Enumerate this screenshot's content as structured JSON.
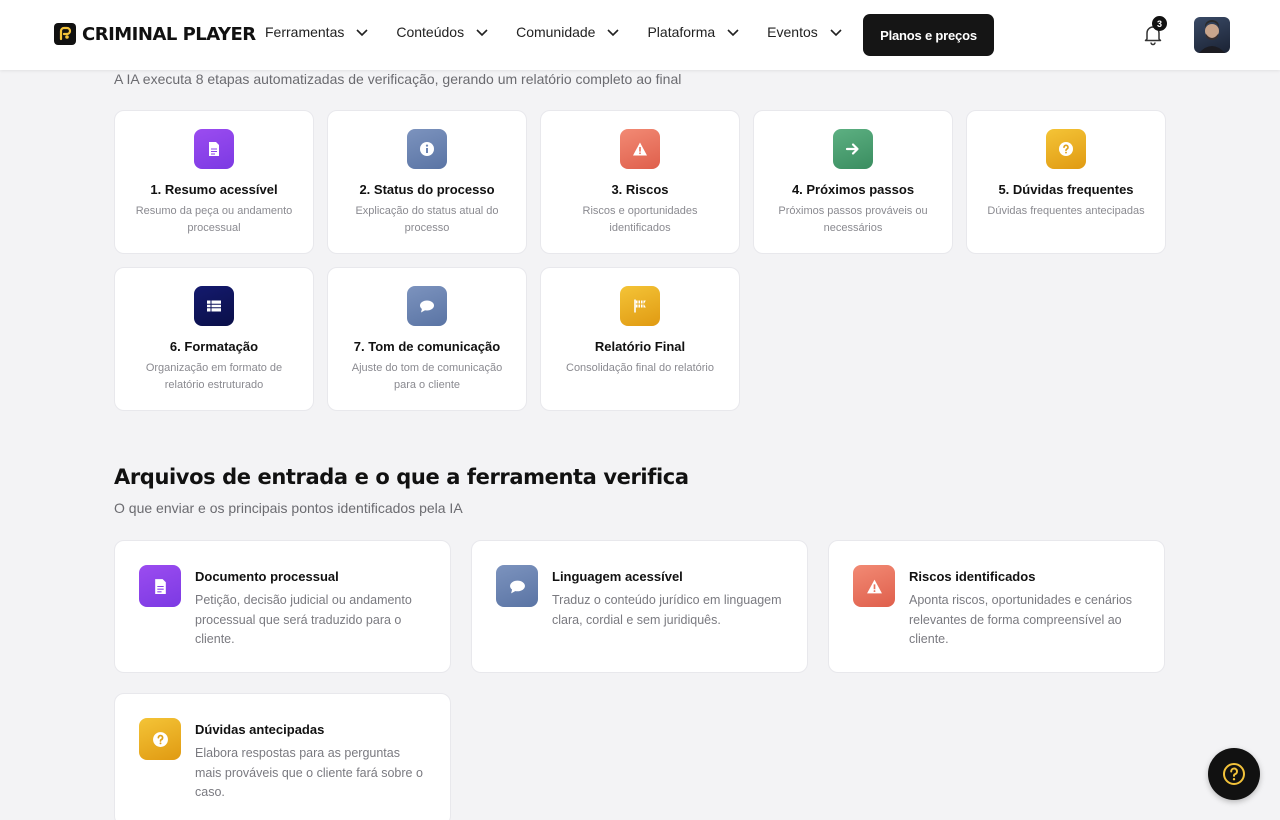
{
  "header": {
    "logo_text": "CRIMINAL PLAYER",
    "nav": [
      {
        "label": "Ferramentas"
      },
      {
        "label": "Conteúdos"
      },
      {
        "label": "Comunidade"
      },
      {
        "label": "Plataforma"
      },
      {
        "label": "Eventos"
      }
    ],
    "cta_label": "Planos e preços",
    "notification_count": "3"
  },
  "steps_section": {
    "subtitle": "A IA executa 8 etapas automatizadas de verificação, gerando um relatório completo ao final",
    "steps": [
      {
        "title": "1. Resumo acessível",
        "desc": "Resumo da peça ou andamento processual",
        "icon": "document-icon",
        "color": "#8b44ea"
      },
      {
        "title": "2. Status do processo",
        "desc": "Explicação do status atual do processo",
        "icon": "info-icon",
        "color": "#6c84b3"
      },
      {
        "title": "3. Riscos",
        "desc": "Riscos e oportunidades identificados",
        "icon": "warning-icon",
        "color": "#e8725e"
      },
      {
        "title": "4. Próximos passos",
        "desc": "Próximos passos prováveis ou necessários",
        "icon": "arrow-right-icon",
        "color": "#4b9f72"
      },
      {
        "title": "5. Dúvidas frequentes",
        "desc": "Dúvidas frequentes antecipadas",
        "icon": "question-icon",
        "color": "#eaaf25"
      },
      {
        "title": "6. Formatação",
        "desc": "Organização em formato de relatório estruturado",
        "icon": "table-icon",
        "color": "#0f145c"
      },
      {
        "title": "7. Tom de comunicação",
        "desc": "Ajuste do tom de comunicação para o cliente",
        "icon": "chat-icon",
        "color": "#6c84b3"
      },
      {
        "title": "Relatório Final",
        "desc": "Consolidação final do relatório",
        "icon": "flag-icon",
        "color": "#eaaf25"
      }
    ]
  },
  "inputs_section": {
    "title": "Arquivos de entrada e o que a ferramenta verifica",
    "subtitle": "O que enviar e os principais pontos identificados pela IA",
    "cards": [
      {
        "title": "Documento processual",
        "desc": "Petição, decisão judicial ou andamento processual que será traduzido para o cliente.",
        "icon": "document-icon"
      },
      {
        "title": "Linguagem acessível",
        "desc": "Traduz o conteúdo jurídico em linguagem clara, cordial e sem juridiquês.",
        "icon": "chat-icon"
      },
      {
        "title": "Riscos identificados",
        "desc": "Aponta riscos, oportunidades e cenários relevantes de forma compreensível ao cliente.",
        "icon": "warning-icon"
      },
      {
        "title": "Dúvidas antecipadas",
        "desc": "Elabora respostas para as perguntas mais prováveis que o cliente fará sobre o caso.",
        "icon": "question-icon"
      }
    ]
  },
  "help_icon": "help-circle-icon"
}
